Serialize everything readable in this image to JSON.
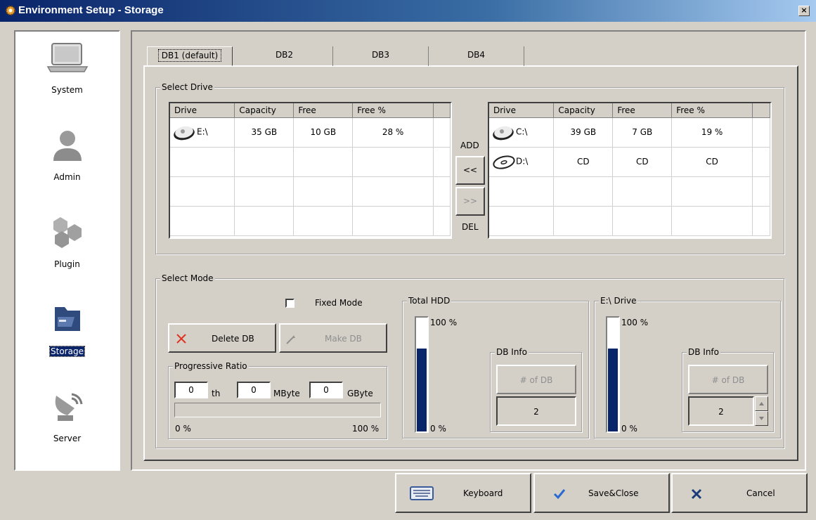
{
  "window": {
    "title": "Environment Setup - Storage",
    "close_glyph": "×"
  },
  "nav": {
    "items": [
      {
        "label": "System",
        "icon": "laptop-icon"
      },
      {
        "label": "Admin",
        "icon": "user-icon"
      },
      {
        "label": "Plugin",
        "icon": "hexagons-icon"
      },
      {
        "label": "Storage",
        "icon": "folder-icon",
        "selected": true
      },
      {
        "label": "Server",
        "icon": "satellite-dish-icon"
      }
    ]
  },
  "tabs": [
    "DB1 (default)",
    "DB2",
    "DB3",
    "DB4"
  ],
  "select_drive": {
    "title": "Select Drive",
    "columns": [
      "Drive",
      "Capacity",
      "Free",
      "Free %"
    ],
    "left_rows": [
      {
        "drive": "E:\\",
        "capacity": "35 GB",
        "free": "10 GB",
        "free_pct": "28 %",
        "icon": "hdd-icon"
      }
    ],
    "right_rows": [
      {
        "drive": "C:\\",
        "capacity": "39 GB",
        "free": "7 GB",
        "free_pct": "19 %",
        "icon": "hdd-icon"
      },
      {
        "drive": "D:\\",
        "capacity": "CD",
        "free": "CD",
        "free_pct": "CD",
        "icon": "cd-icon"
      }
    ],
    "add_label": "ADD",
    "add_button": "<<",
    "del_button": ">>",
    "del_label": "DEL"
  },
  "select_mode": {
    "title": "Select Mode",
    "fixed_mode_label": "Fixed Mode",
    "fixed_mode_checked": false,
    "delete_db": "Delete DB",
    "make_db": "Make DB",
    "progressive_ratio": {
      "title": "Progressive Ratio",
      "th_value": "0",
      "th_unit": "th",
      "mbyte_value": "0",
      "mbyte_unit": "MByte",
      "gbyte_value": "0",
      "gbyte_unit": "GByte",
      "min_label": "0 %",
      "max_label": "100 %",
      "progress": 0
    },
    "total_hdd": {
      "title": "Total HDD",
      "top_label": "100 %",
      "bottom_label": "0 %",
      "level": 0.73,
      "db_info_title": "DB Info",
      "num_db_label": "# of DB",
      "num_db_value": "2"
    },
    "drive_panel": {
      "title": "E:\\ Drive",
      "top_label": "100 %",
      "bottom_label": "0 %",
      "level": 0.73,
      "db_info_title": "DB Info",
      "num_db_label": "# of DB",
      "num_db_value": "2"
    }
  },
  "footer": {
    "keyboard": "Keyboard",
    "save_close": "Save&Close",
    "cancel": "Cancel"
  },
  "colors": {
    "titlebar": "#0a246a",
    "gauge_fill": "#0a246a",
    "delete_x": "#e03020",
    "check": "#2a6ad0"
  }
}
